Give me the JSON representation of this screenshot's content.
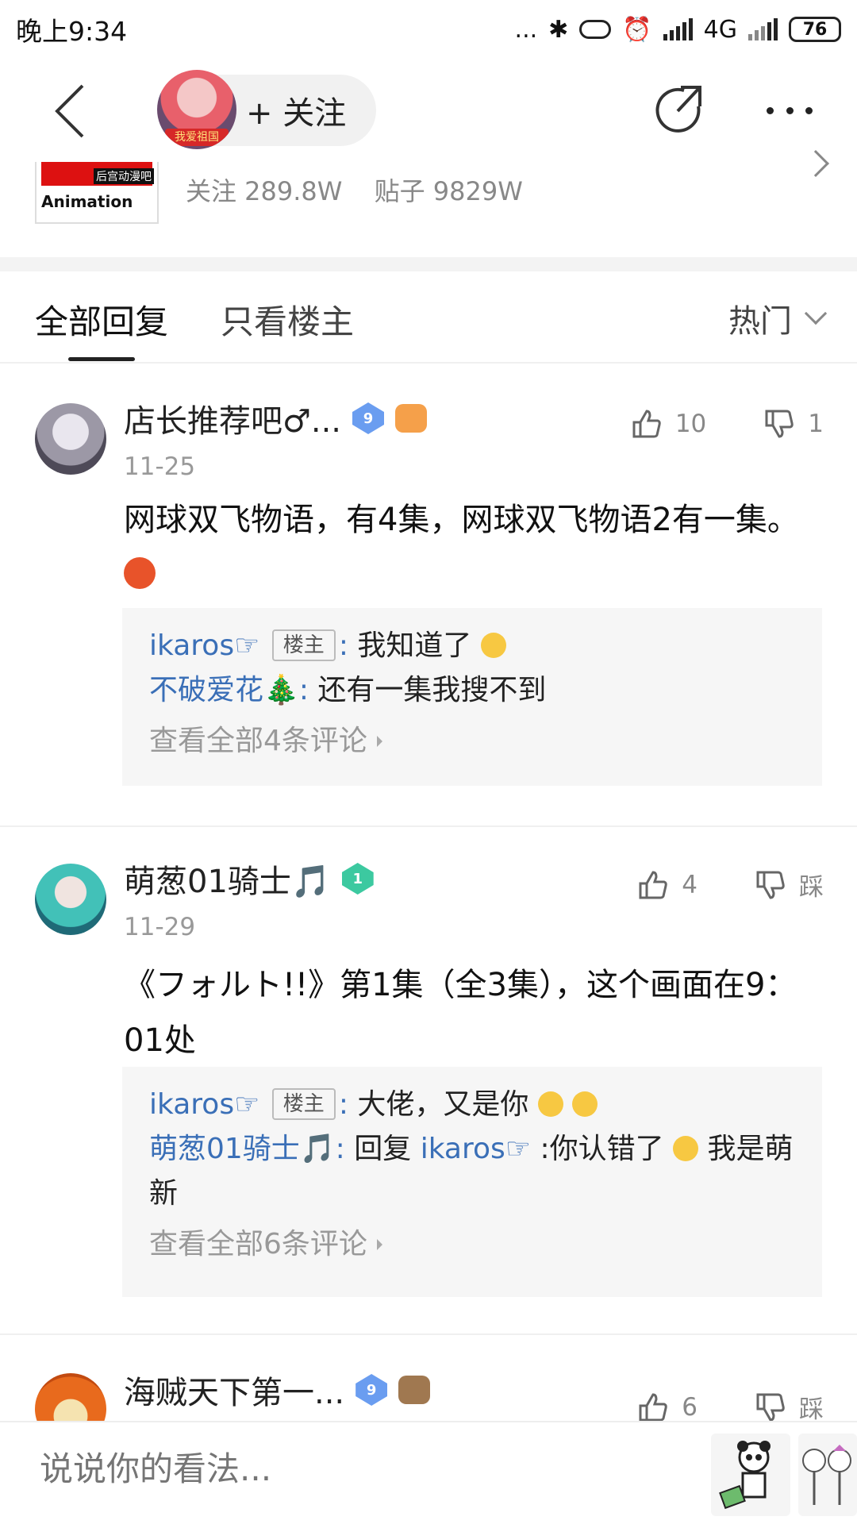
{
  "status_bar": {
    "time": "晚上9:34",
    "dots": "...",
    "network": "4G",
    "battery": "76"
  },
  "nav": {
    "follow_label": "+ 关注",
    "avatar_badge": "我爱祖国"
  },
  "forum": {
    "logo_text": "Animation",
    "logo_tag": "后宫动漫吧",
    "followers": "关注 289.8W",
    "posts": "贴子 9829W"
  },
  "tabs": {
    "all": "全部回复",
    "owner_only": "只看楼主",
    "sort": "热门"
  },
  "colors": {
    "link_blue": "#3a6fb7",
    "level_blue": "#6a9df0",
    "level_green": "#3cc9a0"
  },
  "replies": [
    {
      "username": "店长推荐吧♂...",
      "level": "9",
      "date": "11-25",
      "likes": "10",
      "dislikes": "1",
      "body": "网球双飞物语，有4集，网球双飞物语2有一集。",
      "sub_comments": [
        {
          "user": "ikaros☞",
          "owner_tag": "楼主",
          "text": "我知道了"
        },
        {
          "user": "不破爱花🎄",
          "text": "还有一集我搜不到"
        }
      ],
      "see_all": "查看全部4条评论"
    },
    {
      "username": "萌葱01骑士🎵",
      "level": "1",
      "date": "11-29",
      "likes": "4",
      "dislikes": "踩",
      "body": "《フォルト!!》第1集（全3集），这个画面在9：01处",
      "sub_comments": [
        {
          "user": "ikaros☞",
          "owner_tag": "楼主",
          "text": "大佬，又是你"
        },
        {
          "user": "萌葱01骑士🎵",
          "reply_prefix": "回复",
          "reply_to": "ikaros☞",
          "text_a": ":你认错了",
          "text_b": "我是萌新"
        }
      ],
      "see_all": "查看全部6条评论"
    },
    {
      "username": "海贼天下第一...",
      "level": "9",
      "likes": "6",
      "dislikes": "踩"
    }
  ],
  "input": {
    "placeholder": "说说你的看法..."
  }
}
